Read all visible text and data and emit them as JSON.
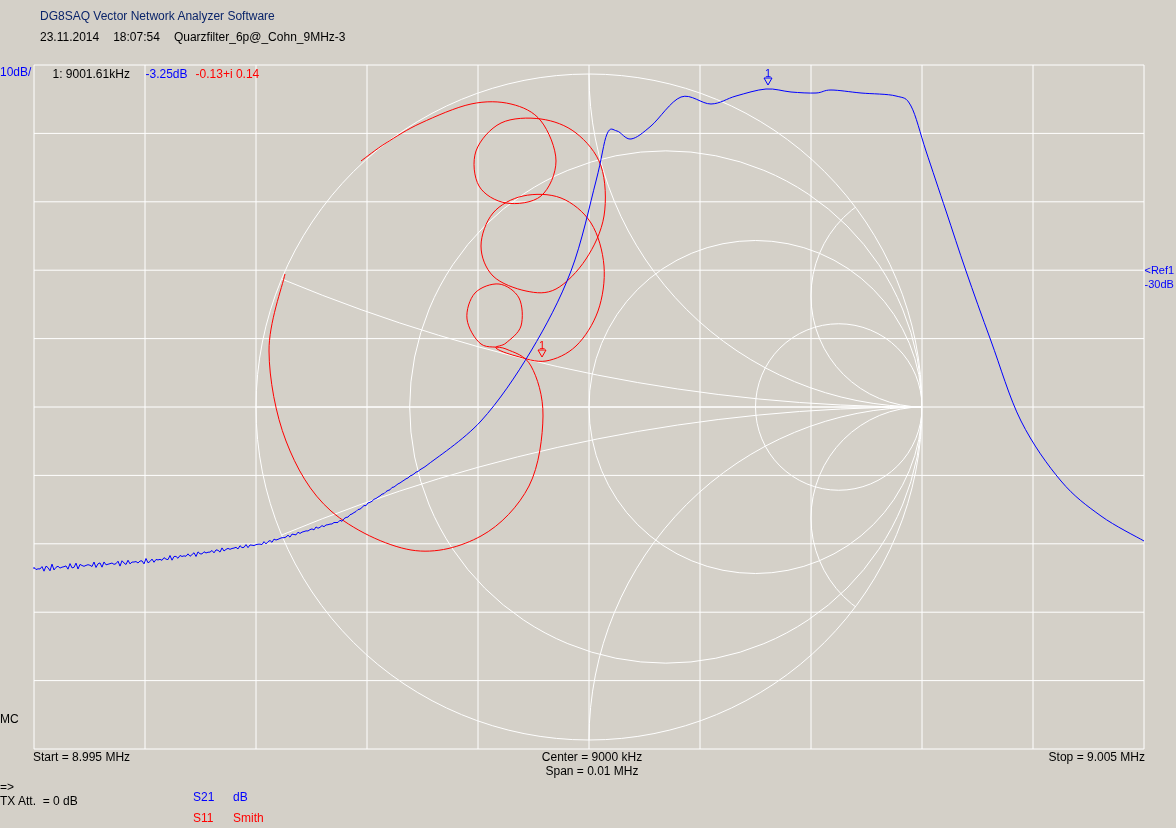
{
  "window": {
    "title": "DG8SAQ Vector Network Analyzer Software"
  },
  "header": {
    "date": "23.11.2014",
    "time": "18:07:54",
    "file": "Quarzfilter_6p@_Cohn_9MHz-3"
  },
  "plot": {
    "scale_label": "10dB/",
    "mode_label": "MC",
    "marker_readout": {
      "frequency": "1: 9001.61kHz",
      "values": [
        "-3.25dB",
        "-0.13+i 0.14"
      ]
    },
    "reference": {
      "name": "<Ref1",
      "value": "-30dB"
    }
  },
  "sweep": {
    "start": "Start = 8.995 MHz",
    "center": "Center = 9000 kHz",
    "span": "Span = 0.01 MHz",
    "stop": "Stop = 9.005 MHz"
  },
  "status": {
    "arrow": "=>",
    "tx_att": "TX Att.  = 0 dB"
  },
  "traces": [
    {
      "parameter": "S21",
      "format": "dB",
      "color": "#0000ff",
      "kind": "rect",
      "marker": "1"
    },
    {
      "parameter": "S11",
      "format": "Smith",
      "color": "#ff0000",
      "kind": "smith",
      "marker": "1"
    }
  ]
}
